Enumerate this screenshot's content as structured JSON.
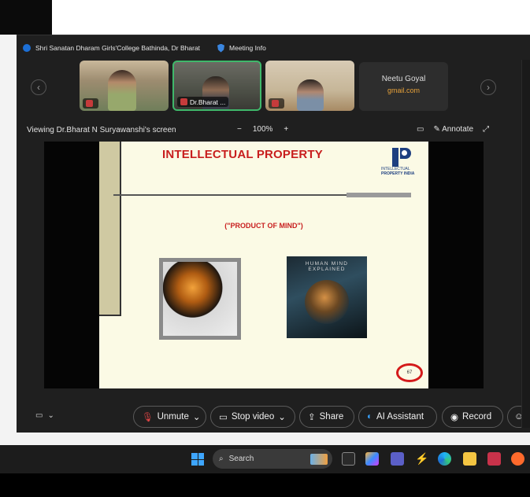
{
  "window": {
    "title": "Shri Sanatan Dharam Girls'College Bathinda, Dr Bharat",
    "meeting_info": "Meeting Info"
  },
  "participants": [
    {
      "label": "",
      "muted": true
    },
    {
      "label": "Dr.Bharat ...",
      "muted": true
    },
    {
      "label": "",
      "muted": true
    }
  ],
  "name_tile": {
    "name": "Neetu Goyal",
    "email": "gmail.com"
  },
  "share": {
    "viewing": "Viewing Dr.Bharat N Suryawanshi's screen",
    "zoom_minus": "−",
    "zoom": "100%",
    "zoom_plus": "+",
    "annotate": "Annotate"
  },
  "slide": {
    "title": "INTELLECTUAL PROPERTY",
    "logo_text1": "INTELLECTUAL",
    "logo_text2": "PROPERTY INDIA",
    "subtitle": "(\"PRODUCT OF MIND\")",
    "book_title": "HUMAN MIND EXPLAINED",
    "page_mark": "67"
  },
  "controls": {
    "unmute": "Unmute",
    "stop_video": "Stop video",
    "share": "Share",
    "ai_assistant": "AI Assistant",
    "record": "Record"
  },
  "taskbar": {
    "search_placeholder": "Search"
  },
  "colors": {
    "accent_red": "#c81e1e",
    "brand_blue": "#1c6fd6"
  }
}
